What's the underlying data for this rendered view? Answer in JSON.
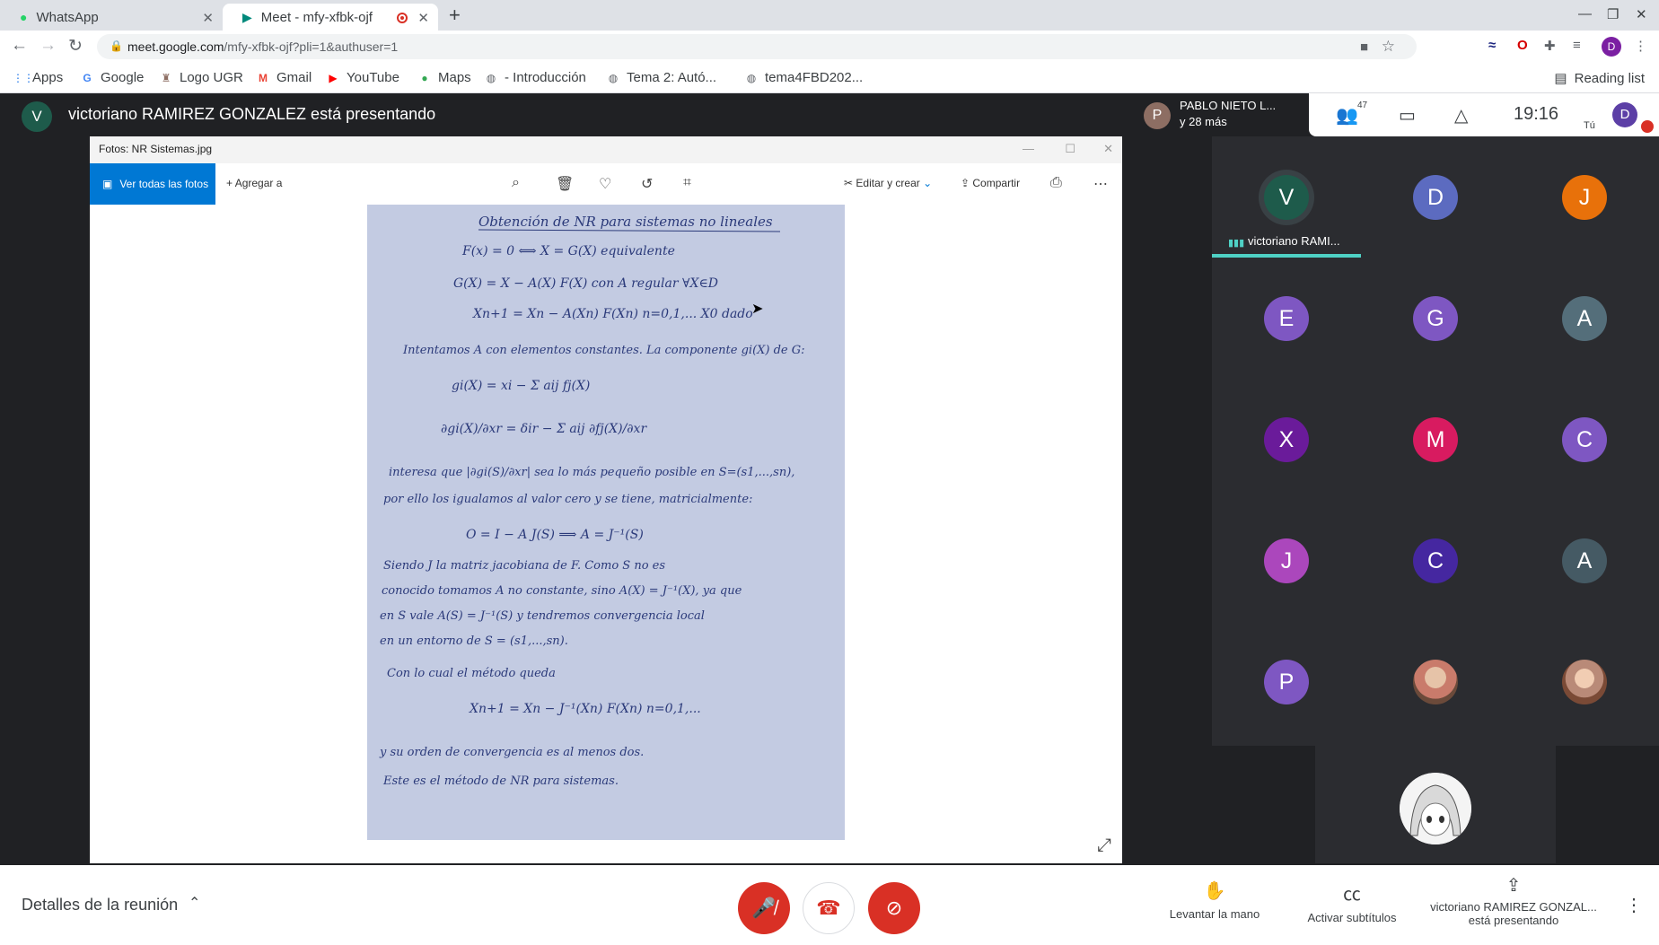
{
  "browser": {
    "tabs": [
      {
        "title": "WhatsApp",
        "icon": "whatsapp-icon",
        "active": false
      },
      {
        "title": "Meet - mfy-xfbk-ojf",
        "icon": "meet-icon",
        "active": true
      }
    ],
    "url_host": "meet.google.com",
    "url_path": "/mfy-xfbk-ojf?pli=1&authuser=1",
    "bookmarks": [
      {
        "label": "Apps",
        "icon": "apps-grid-icon"
      },
      {
        "label": "Google",
        "icon": "google-icon"
      },
      {
        "label": "Logo UGR",
        "icon": "ugr-icon"
      },
      {
        "label": "Gmail",
        "icon": "gmail-icon"
      },
      {
        "label": "YouTube",
        "icon": "youtube-icon"
      },
      {
        "label": "Maps",
        "icon": "maps-icon"
      },
      {
        "label": "- Introducción",
        "icon": "globe-icon"
      },
      {
        "label": "Tema 2: Autó...",
        "icon": "globe-icon"
      },
      {
        "label": "tema4FBD202...",
        "icon": "globe-icon"
      }
    ],
    "reading_list": "Reading list",
    "profile_initial": "D"
  },
  "meet": {
    "presenter_initial": "V",
    "presenter_text": "victoriano RAMIREZ GONZALEZ está presentando",
    "others": {
      "initial": "P",
      "name": "PABLO NIETO L...",
      "more": "y 28 más"
    },
    "participant_count": "47",
    "clock": "19:16",
    "me_initial": "D",
    "me_label": "Tú",
    "photos": {
      "window_title": "Fotos: NR Sistemas.jpg",
      "see_all": "Ver todas las fotos",
      "add_to": "Agregar a",
      "edit_create": "Editar y crear",
      "share": "Compartir"
    },
    "notes": {
      "lines": [
        "Obtención de NR para sistemas no lineales",
        "F(x) = 0  ⟺  X = G(X)   equivalente",
        "G(X) = X − A(X) F(X)    con A regular ∀X∈D",
        "Xn+1 = Xn − A(Xn) F(Xn)   n=0,1,...   X0 dado",
        "Intentamos A con elementos constantes. La componente gi(X) de G:",
        "gi(X) = xi − Σ aij fj(X)",
        "∂gi(X)/∂xr = δir − Σ aij ∂fj(X)/∂xr",
        "interesa que |∂gi(S)/∂xr| sea lo más pequeño posible en S=(s1,...,sn),",
        "por ello los igualamos al valor cero y se tiene, matricialmente:",
        "O = I − A J(S)   ⟹   A = J⁻¹(S)",
        "Siendo J la matriz jacobiana de F. Como S no es",
        "conocido tomamos A no constante, sino A(X) = J⁻¹(X), ya que",
        "en S vale A(S) = J⁻¹(S) y tendremos convergencia local",
        "en un entorno de S = (s1,...,sn).",
        "Con lo cual el método queda",
        "Xn+1 = Xn − J⁻¹(Xn) F(Xn)     n=0,1,...",
        "y su orden de convergencia es al menos dos.",
        "Este es el método de NR para sistemas."
      ]
    },
    "speaker": {
      "initial": "V",
      "name": "victoriano RAMI...",
      "color": "#1e5b4b"
    },
    "participants": [
      {
        "initial": "D",
        "color": "#5c6bc0"
      },
      {
        "initial": "J",
        "color": "#e8710a"
      },
      {
        "initial": "E",
        "color": "#7e57c2"
      },
      {
        "initial": "G",
        "color": "#7e57c2"
      },
      {
        "initial": "A",
        "color": "#546e7a"
      },
      {
        "initial": "X",
        "color": "#6a1b9a"
      },
      {
        "initial": "M",
        "color": "#d81b60"
      },
      {
        "initial": "C",
        "color": "#7e57c2"
      },
      {
        "initial": "J",
        "color": "#ab47bc"
      },
      {
        "initial": "C",
        "color": "#4527a0"
      },
      {
        "initial": "A",
        "color": "#455a64"
      },
      {
        "initial": "P",
        "color": "#7e57c2"
      },
      {
        "initial": "",
        "color": "#c97b6b"
      },
      {
        "initial": "",
        "color": "#b98a78"
      }
    ],
    "bottom": {
      "details": "Detalles de la reunión",
      "raise_hand": "Levantar la mano",
      "subtitles": "Activar subtítulos",
      "presenting_name": "victoriano RAMIREZ GONZAL...",
      "presenting_status": "está presentando"
    }
  }
}
